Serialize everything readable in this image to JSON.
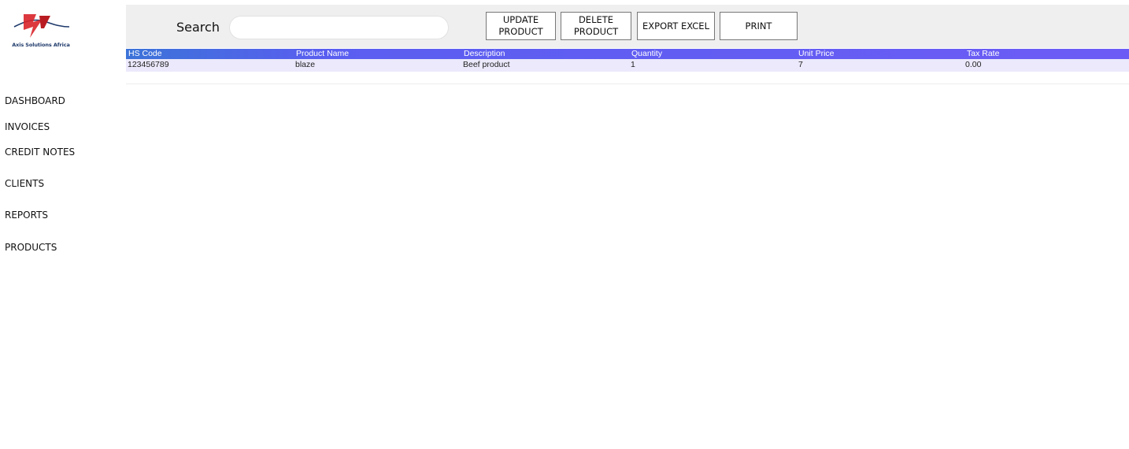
{
  "brand": {
    "name": "Axis Solutions Africa",
    "colors": {
      "red": "#d8232a",
      "dark": "#1f3a6b"
    }
  },
  "nav": {
    "items": [
      {
        "label": "DASHBOARD"
      },
      {
        "label": "INVOICES"
      },
      {
        "label": "CREDIT NOTES"
      },
      {
        "label": "CLIENTS"
      },
      {
        "label": "REPORTS"
      },
      {
        "label": "PRODUCTS"
      }
    ]
  },
  "toolbar": {
    "search_label": "Search",
    "search_value": "",
    "update_label": "UPDATE\nPRODUCT",
    "delete_label": "DELETE\nPRODUCT",
    "export_label": "EXPORT EXCEL",
    "print_label": "PRINT"
  },
  "table": {
    "header_color": "#6c5cf5",
    "row_color": "#ebe9fb",
    "columns": [
      "HS Code",
      "Product Name",
      "Description",
      "Quantity",
      "Unit Price",
      "Tax Rate"
    ],
    "rows": [
      [
        "123456789",
        "blaze",
        "Beef product",
        "1",
        "7",
        "0.00"
      ]
    ]
  }
}
